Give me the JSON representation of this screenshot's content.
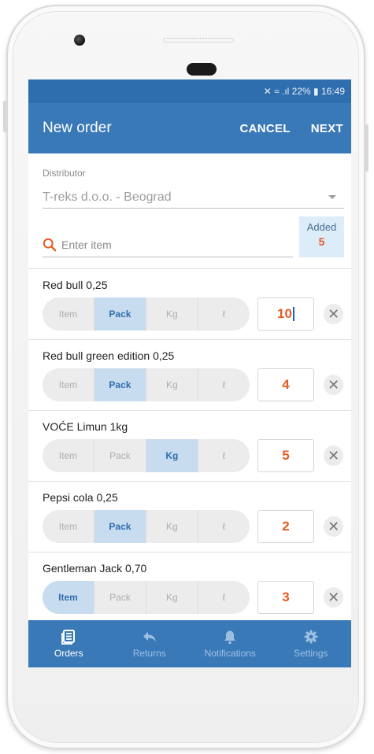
{
  "status": {
    "text": "✕ ≈ .ıl 22% ▮ 16:49"
  },
  "appbar": {
    "title": "New order",
    "cancel_label": "CANCEL",
    "next_label": "NEXT"
  },
  "form": {
    "distributor_label": "Distributor",
    "distributor_value": "T-reks d.o.o. - Beograd",
    "search_placeholder": "Enter item",
    "added_label": "Added",
    "added_count": "5"
  },
  "unit_options": [
    "Item",
    "Pack",
    "Kg",
    "ℓ"
  ],
  "items": [
    {
      "name": "Red bull 0,25",
      "selected_unit": "Pack",
      "quantity": "10"
    },
    {
      "name": "Red bull green edition 0,25",
      "selected_unit": "Pack",
      "quantity": "4"
    },
    {
      "name": "VOĆE Limun 1kg",
      "selected_unit": "Kg",
      "quantity": "5"
    },
    {
      "name": "Pepsi cola 0,25",
      "selected_unit": "Pack",
      "quantity": "2"
    },
    {
      "name": "Gentleman Jack 0,70",
      "selected_unit": "Item",
      "quantity": "3"
    }
  ],
  "nav": {
    "orders": "Orders",
    "returns": "Returns",
    "notifications": "Notifications",
    "settings": "Settings",
    "active": "Orders"
  },
  "colors": {
    "primary": "#3a79b8",
    "statusbar": "#2f6eae",
    "accent": "#e85b23",
    "selected_segment": "#c8dcf0"
  }
}
